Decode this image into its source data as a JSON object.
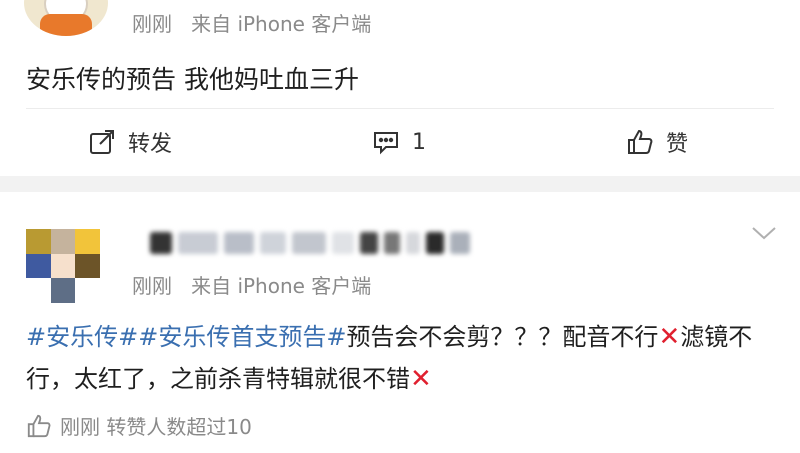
{
  "post1": {
    "meta_time": "刚刚",
    "meta_source": "来自",
    "meta_device": "iPhone 客户端",
    "text": "安乐传的预告 我他妈吐血三升",
    "actions": {
      "repost_label": "转发",
      "comment_count": "1",
      "like_label": "赞"
    }
  },
  "post2": {
    "meta_time": "刚刚",
    "meta_source": "来自",
    "meta_device": "iPhone 客户端",
    "tag1": "#安乐传#",
    "tag2": "#安乐传首支预告#",
    "body_part1": "预告会不会剪？？？配音不行",
    "cross1": "✕",
    "body_part2": "滤镜不行，太红了，之前杀青特辑就很不错",
    "cross2": "✕",
    "footer_time": "刚刚",
    "footer_stats": "转赞人数超过10"
  },
  "colors": {
    "link": "#3a6fb0",
    "meta": "#8a8a8a",
    "cross": "#e0202f",
    "divider": "#f2f2f2"
  },
  "icons": [
    "repost-icon",
    "comment-icon",
    "thumbs-up-icon",
    "chevron-down-icon"
  ]
}
